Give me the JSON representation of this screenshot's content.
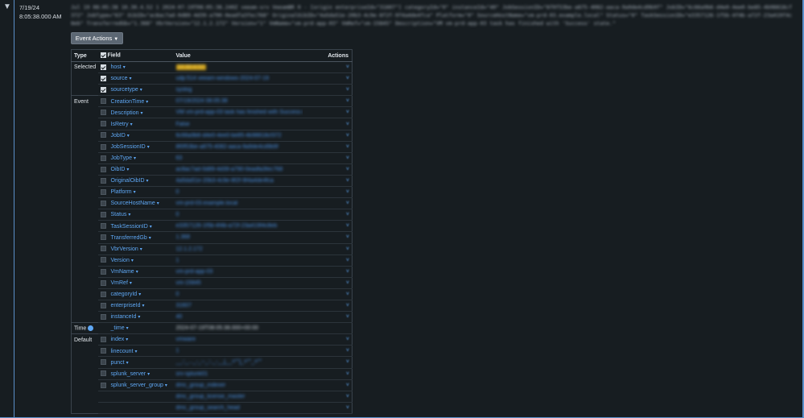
{
  "event": {
    "date": "7/19/24",
    "time": "8:05:38.000 AM",
    "raw": "Jul 19 08:05:38 10.30.4.52 1 2024-07-19T08:05:38.240Z veeam-srv VeeamBR 0 - [origin enterpriseId=\"31607\"] categoryId=\"0\" instanceId=\"40\" JobSessionID=\"8f0f53be-a875-4082-aaca-9a9de4cd9b9f\" JobID=\"6c66a9b6-d4e0-4ee0-be85-4b98818cf372\" JobType=\"63\" OibID=\"ac8ac7ad-0d89-4d39-a790-0eadfa3fec768\" OriginalOibID=\"4a5da51e-20b3-4c9e-8f2f-9f4a4de4fca\" Platform=\"0\" SourceHostName=\"vm-prd-03.example.local\" Status=\"0\" TaskSessionID=\"e3357126-1f5b-4f4b-a72f-23a419f4c8eb\" TransferredGb=\"1.368\" VbrVersion=\"12.1.2.172\" Version=\"1\" VmName=\"vm-prd-app-03\" VmRef=\"vm-15845\" Description=\"VM vm-prd-app-03 task has finished with 'Success' state.\"",
    "actions_label": "Event Actions"
  },
  "table": {
    "headers": {
      "type": "Type",
      "field": "Field",
      "value": "Value",
      "actions": "Actions"
    },
    "rows": [
      {
        "type": "Selected",
        "field": "host",
        "value": "10.30.4.52",
        "checked": true,
        "value_style": "hl"
      },
      {
        "type": "",
        "field": "source",
        "value": "udp:514 veeam-windows-2024-07-19",
        "checked": true,
        "value_style": "link"
      },
      {
        "type": "",
        "field": "sourcetype",
        "value": "syslog",
        "checked": true,
        "value_style": "link"
      },
      {
        "type": "Event",
        "field": "CreationTime",
        "value": "07/19/2024 08:05:38",
        "checked": false,
        "value_style": "link"
      },
      {
        "type": "",
        "field": "Description",
        "value": "VM vm-prd-app-03 task has finished with Success state",
        "checked": false,
        "value_style": "link"
      },
      {
        "type": "",
        "field": "IsRetry",
        "value": "False",
        "checked": false,
        "value_style": "link"
      },
      {
        "type": "",
        "field": "JobID",
        "value": "6c66a9b6-d4e0-4ee0-be85-4b98818cf372",
        "checked": false,
        "value_style": "link"
      },
      {
        "type": "",
        "field": "JobSessionID",
        "value": "8f0f53be-a875-4082-aaca-9a9de4cd9b9f",
        "checked": false,
        "value_style": "link"
      },
      {
        "type": "",
        "field": "JobType",
        "value": "63",
        "checked": false,
        "value_style": "link"
      },
      {
        "type": "",
        "field": "OibID",
        "value": "ac8ac7ad-0d89-4d39-a790-0eadfa3fec768",
        "checked": false,
        "value_style": "link"
      },
      {
        "type": "",
        "field": "OriginalOibID",
        "value": "4a5da51e-20b3-4c9e-8f2f-9f4a4de4fca",
        "checked": false,
        "value_style": "link"
      },
      {
        "type": "",
        "field": "Platform",
        "value": "0",
        "checked": false,
        "value_style": "link"
      },
      {
        "type": "",
        "field": "SourceHostName",
        "value": "vm-prd-03.example.local",
        "checked": false,
        "value_style": "link"
      },
      {
        "type": "",
        "field": "Status",
        "value": "0",
        "checked": false,
        "value_style": "link"
      },
      {
        "type": "",
        "field": "TaskSessionID",
        "value": "e3357126-1f5b-4f4b-a72f-23a419f4c8eb",
        "checked": false,
        "value_style": "link"
      },
      {
        "type": "",
        "field": "TransferredGb",
        "value": "1.368",
        "checked": false,
        "value_style": "link"
      },
      {
        "type": "",
        "field": "VbrVersion",
        "value": "12.1.2.172",
        "checked": false,
        "value_style": "link"
      },
      {
        "type": "",
        "field": "Version",
        "value": "1",
        "checked": false,
        "value_style": "link"
      },
      {
        "type": "",
        "field": "VmName",
        "value": "vm-prd-app-03",
        "checked": false,
        "value_style": "link"
      },
      {
        "type": "",
        "field": "VmRef",
        "value": "vm-15845",
        "checked": false,
        "value_style": "link"
      },
      {
        "type": "",
        "field": "categoryId",
        "value": "0",
        "checked": false,
        "value_style": "link"
      },
      {
        "type": "",
        "field": "enterpriseId",
        "value": "31607",
        "checked": false,
        "value_style": "link"
      },
      {
        "type": "",
        "field": "instanceId",
        "value": "40",
        "checked": false,
        "value_style": "link"
      },
      {
        "type": "Time",
        "field": "_time",
        "value": "2024-07-19T08:05:38.000+00:00",
        "checked": null,
        "value_style": "plain",
        "type_icon": true
      },
      {
        "type": "Default",
        "field": "index",
        "value": "vmware",
        "checked": false,
        "value_style": "link"
      },
      {
        "type": "",
        "field": "linecount",
        "value": "1",
        "checked": false,
        "value_style": "link"
      },
      {
        "type": "",
        "field": "punct",
        "value": "__::_..._-_--_::._-__[__=\"\"]_=\"\"_=\"\"",
        "checked": false,
        "value_style": "link"
      },
      {
        "type": "",
        "field": "splunk_server",
        "value": "srv-splunk01",
        "checked": false,
        "value_style": "link"
      },
      {
        "type": "",
        "field": "splunk_server_group",
        "value": "dmc_group_indexer",
        "checked": false,
        "value_style": "link"
      },
      {
        "type": "",
        "field": "",
        "value": "dmc_group_license_master",
        "checked": null,
        "value_style": "link"
      },
      {
        "type": "",
        "field": "",
        "value": "dmc_group_search_head",
        "checked": null,
        "value_style": "link"
      }
    ]
  }
}
